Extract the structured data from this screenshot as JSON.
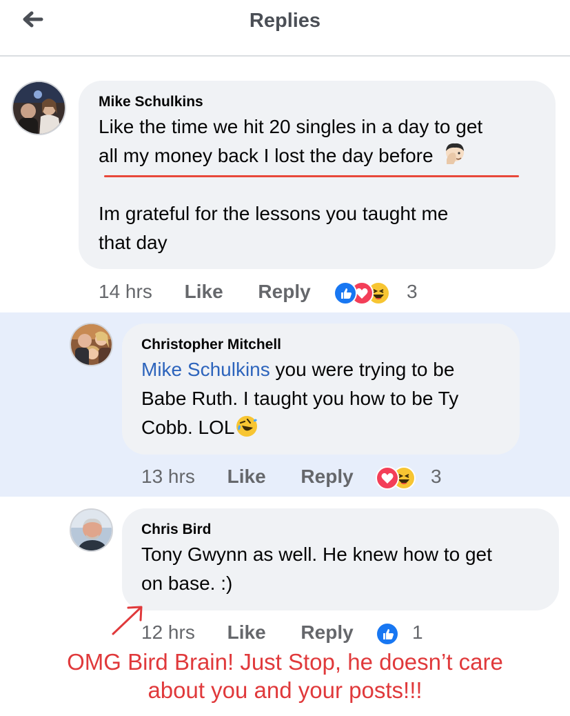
{
  "header": {
    "title": "Replies",
    "back_icon": "back-arrow-icon"
  },
  "comments": [
    {
      "author": "Mike Schulkins",
      "text_line1": "Like the time we hit 20 singles in a day to get",
      "text_line2": "all my money back I lost the day before",
      "text_emoji": "face-palm-emoji",
      "text_para2_line1": "Im grateful for the lessons you taught me",
      "text_para2_line2": "that day",
      "time": "14 hrs",
      "like_label": "Like",
      "reply_label": "Reply",
      "reactions": [
        "like-reaction-icon",
        "love-reaction-icon",
        "haha-reaction-icon"
      ],
      "reaction_count": "3"
    },
    {
      "author": "Christopher Mitchell",
      "mention": "Mike Schulkins",
      "text_after_mention": " you were trying to be",
      "text_line2": "Babe Ruth. I taught you how to be Ty",
      "text_line3": "Cobb. LOL",
      "text_emoji": "rolling-laughing-emoji",
      "time": "13 hrs",
      "like_label": "Like",
      "reply_label": "Reply",
      "reactions": [
        "love-reaction-icon",
        "haha-reaction-icon"
      ],
      "reaction_count": "3"
    },
    {
      "author": "Chris Bird",
      "text_line1": "Tony Gwynn as well. He knew how to get",
      "text_line2": "on base. :)",
      "time": "12 hrs",
      "like_label": "Like",
      "reply_label": "Reply",
      "reactions": [
        "like-reaction-icon"
      ],
      "reaction_count": "1"
    }
  ],
  "annotation": {
    "line1": "OMG Bird Brain! Just Stop, he doesn’t care",
    "line2": "about you and your posts!!!",
    "color": "#e0393b"
  },
  "colors": {
    "mention": "#2d64bc",
    "highlight_band": "#e7eefb",
    "bubble": "#f0f2f5",
    "underline": "#e8483a"
  }
}
